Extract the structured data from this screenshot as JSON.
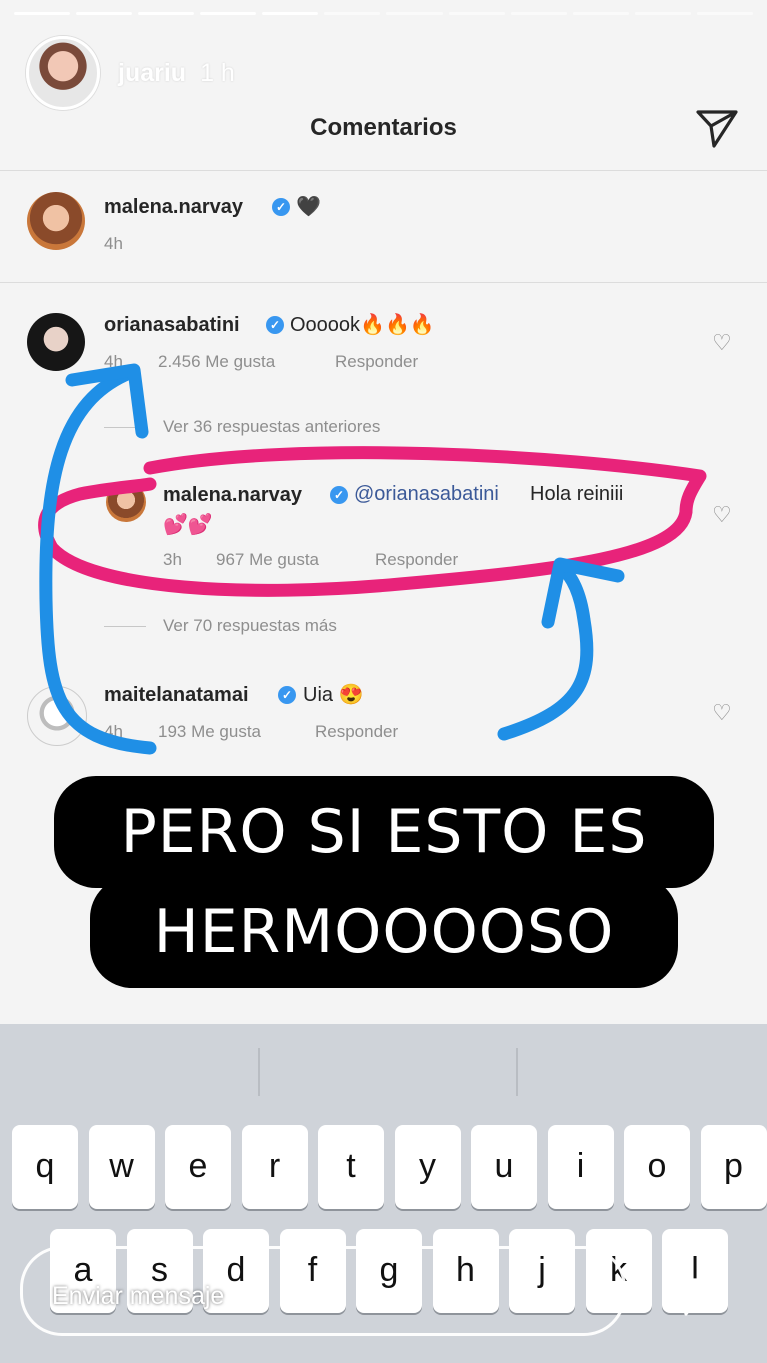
{
  "story": {
    "username": "juariu",
    "time": "1 h"
  },
  "header": {
    "title": "Comentarios"
  },
  "comments": [
    {
      "username": "malena.narvay",
      "text": "🖤",
      "time": "4h"
    },
    {
      "username": "orianasabatini",
      "text": "Oooook🔥🔥🔥",
      "time": "4h",
      "likes": "2.456 Me gusta",
      "reply": "Responder"
    },
    {
      "username": "malena.narvay",
      "mention": "@orianasabatini",
      "text": "Hola reiniii",
      "emoji": "💕💕",
      "time": "3h",
      "likes": "967 Me gusta",
      "reply": "Responder"
    },
    {
      "username": "maitelanatamai",
      "text": "Uia 😍",
      "time": "4h",
      "likes": "193 Me gusta",
      "reply": "Responder"
    }
  ],
  "replies": {
    "previous": "Ver 36 respuestas anteriores",
    "more": "Ver 70 respuestas más"
  },
  "caption": {
    "line1": "PERO SI ESTO ES",
    "line2": "HERMOOOOSO"
  },
  "keyboard": {
    "row1": [
      "q",
      "w",
      "e",
      "r",
      "t",
      "y",
      "u",
      "i",
      "o",
      "p"
    ],
    "row2": [
      "a",
      "s",
      "d",
      "f",
      "g",
      "h",
      "j",
      "k",
      "l"
    ]
  },
  "message": {
    "placeholder": "Enviar mensaje"
  },
  "colors": {
    "circle": "#e8237a",
    "arrows": "#1f8fe6",
    "verified": "#3897f0"
  }
}
